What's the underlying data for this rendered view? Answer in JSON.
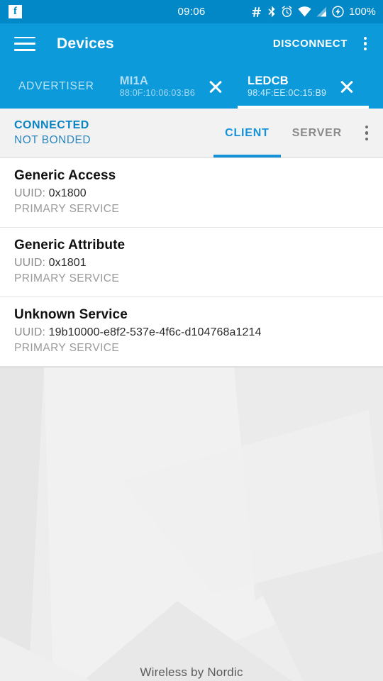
{
  "statusbar": {
    "app_icon": "facebook-icon",
    "app_icon_glyph": "f",
    "time": "09:06",
    "icons": [
      "hash-icon",
      "bluetooth-icon",
      "alarm-icon",
      "wifi-icon",
      "cellular-signal-icon",
      "battery-charging-icon"
    ],
    "battery_percent": "100%"
  },
  "appbar": {
    "menu_icon": "hamburger-menu-icon",
    "title": "Devices",
    "disconnect_label": "DISCONNECT",
    "overflow_icon": "more-vertical-icon"
  },
  "device_tabs": {
    "advertiser_label": "ADVERTISER",
    "tabs": [
      {
        "name": "MI1A",
        "address": "88:0F:10:06:03:B6",
        "active": false,
        "close_icon": "close-icon"
      },
      {
        "name": "LEDCB",
        "address": "98:4F:EE:0C:15:B9",
        "active": true,
        "close_icon": "close-icon"
      }
    ]
  },
  "connection_bar": {
    "connected_label": "CONNECTED",
    "bonded_label": "NOT BONDED",
    "tabs": [
      {
        "label": "CLIENT",
        "active": true
      },
      {
        "label": "SERVER",
        "active": false
      }
    ],
    "overflow_icon": "more-vertical-icon"
  },
  "services": [
    {
      "title": "Generic Access",
      "uuid_label": "UUID:",
      "uuid_value": "0x1800",
      "type": "PRIMARY SERVICE"
    },
    {
      "title": "Generic Attribute",
      "uuid_label": "UUID:",
      "uuid_value": "0x1801",
      "type": "PRIMARY SERVICE"
    },
    {
      "title": "Unknown Service",
      "uuid_label": "UUID:",
      "uuid_value": "19b10000-e8f2-537e-4f6c-d104768a1214",
      "type": "PRIMARY SERVICE"
    }
  ],
  "footer": {
    "text": "Wireless by Nordic"
  },
  "colors": {
    "status_bar": "#0288c7",
    "app_bar": "#0c9ada",
    "accent": "#1592d8",
    "connected_text": "#0b84c4",
    "panel_bg": "#f2f2f2",
    "canvas_bg": "#ededed"
  }
}
